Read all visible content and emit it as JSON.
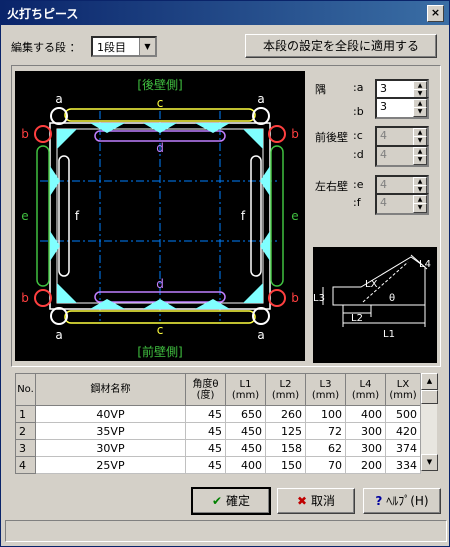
{
  "window": {
    "title": "火打ちピース",
    "close": "×"
  },
  "top": {
    "edit_label": "編集する段 ：",
    "stage_value": "1段目",
    "apply_all_label": "本段の設定を全段に適用する"
  },
  "drawing": {
    "rear_label": "[後壁側]",
    "front_label": "[前壁側]",
    "letters": {
      "a": "a",
      "b": "b",
      "c": "c",
      "d": "d",
      "e": "e",
      "f": "f"
    }
  },
  "params": {
    "corner_label": "隅",
    "front_back_label": "前後壁",
    "left_right_label": "左右壁",
    "a": {
      "key": ":a",
      "value": "3",
      "enabled": true
    },
    "b": {
      "key": ":b",
      "value": "3",
      "enabled": true
    },
    "c": {
      "key": ":c",
      "value": "4",
      "enabled": false
    },
    "d": {
      "key": ":d",
      "value": "4",
      "enabled": false
    },
    "e": {
      "key": ":e",
      "value": "4",
      "enabled": false
    },
    "f": {
      "key": ":f",
      "value": "4",
      "enabled": false
    }
  },
  "diagram": {
    "l1": "L1",
    "l2": "L2",
    "l3": "L3",
    "l4": "L4",
    "lx": "LX",
    "theta": "θ"
  },
  "table": {
    "headers": [
      {
        "line1": "No.",
        "line2": ""
      },
      {
        "line1": "鋼材名称",
        "line2": ""
      },
      {
        "line1": "角度θ",
        "line2": "(度)"
      },
      {
        "line1": "L1",
        "line2": "(mm)"
      },
      {
        "line1": "L2",
        "line2": "(mm)"
      },
      {
        "line1": "L3",
        "line2": "(mm)"
      },
      {
        "line1": "L4",
        "line2": "(mm)"
      },
      {
        "line1": "LX",
        "line2": "(mm)"
      }
    ],
    "rows": [
      [
        "1",
        "40VP",
        "45",
        "650",
        "260",
        "100",
        "400",
        "500"
      ],
      [
        "2",
        "35VP",
        "45",
        "450",
        "125",
        "72",
        "300",
        "420"
      ],
      [
        "3",
        "30VP",
        "45",
        "450",
        "158",
        "62",
        "300",
        "374"
      ],
      [
        "4",
        "25VP",
        "45",
        "400",
        "150",
        "70",
        "200",
        "334"
      ]
    ]
  },
  "buttons": {
    "ok": "確定",
    "cancel": "取消",
    "help": "ﾍﾙﾌﾟ(H)"
  },
  "colors": {
    "accent_yellow": "#ffff40",
    "accent_green": "#40c040",
    "accent_red": "#ff4040",
    "accent_purple": "#c080ff",
    "cyan": "#80ffff"
  }
}
